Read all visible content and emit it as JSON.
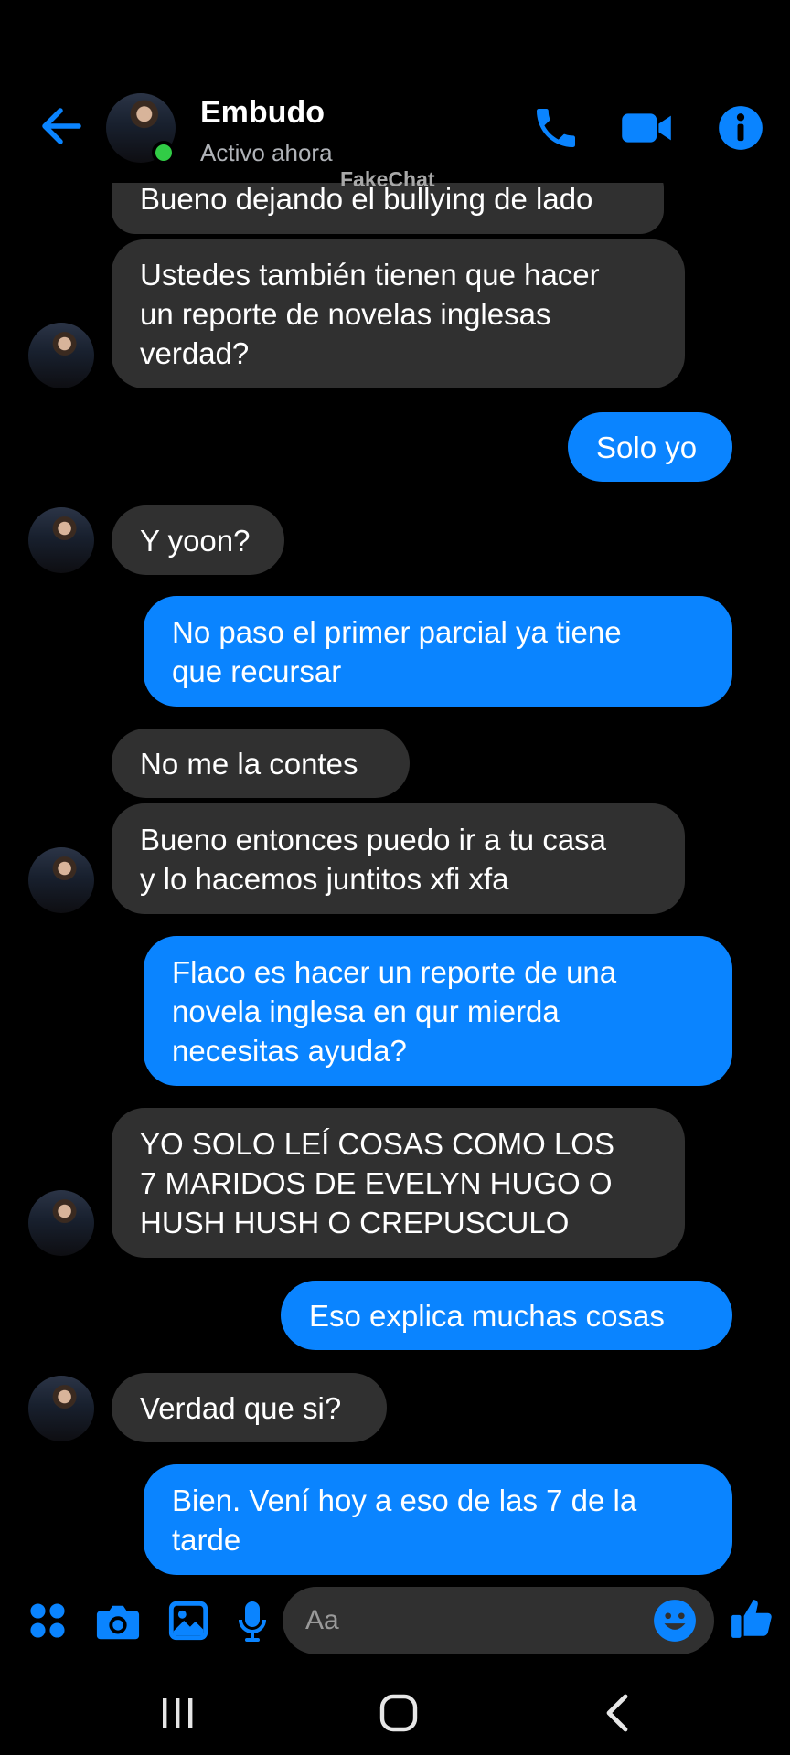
{
  "header": {
    "back_icon": "arrow-left-icon",
    "contact_name": "Embudo",
    "status": "Activo ahora",
    "watermark": "FakeChat",
    "call_icon": "phone-icon",
    "video_icon": "video-camera-icon",
    "info_icon": "info-icon",
    "accent_color": "#0a84ff",
    "online_color": "#31cc46"
  },
  "messages": [
    {
      "from": "contact",
      "text": "Bueno dejando el bullying de lado"
    },
    {
      "from": "contact",
      "text": "Ustedes también tienen que hacer\nun reporte de novelas inglesas\nverdad?"
    },
    {
      "from": "me",
      "text": "Solo yo"
    },
    {
      "from": "contact",
      "text": "Y yoon?"
    },
    {
      "from": "me",
      "text": "No paso el primer parcial ya tiene\nque recursar"
    },
    {
      "from": "contact",
      "text": "No me la contes"
    },
    {
      "from": "contact",
      "text": "Bueno entonces puedo ir a tu casa\ny lo hacemos juntitos xfi xfa"
    },
    {
      "from": "me",
      "text": "Flaco es hacer un reporte de una\nnovela inglesa en qur mierda\nnecesitas ayuda?"
    },
    {
      "from": "contact",
      "text": "YO SOLO LEÍ COSAS COMO LOS\n7 MARIDOS DE EVELYN HUGO O\nHUSH HUSH O CREPUSCULO"
    },
    {
      "from": "me",
      "text": "Eso explica muchas cosas"
    },
    {
      "from": "contact",
      "text": "Verdad que si?"
    },
    {
      "from": "me",
      "text": "Bien. Vení hoy a eso de las 7 de la\ntarde"
    }
  ],
  "composer": {
    "placeholder": "Aa",
    "icons": [
      "apps-grid-icon",
      "camera-icon",
      "gallery-icon",
      "microphone-icon",
      "emoji-icon",
      "thumbs-up-icon"
    ]
  },
  "colors": {
    "incoming_bubble": "#303030",
    "outgoing_bubble": "#0a84ff",
    "background": "#000000"
  },
  "navbar": {
    "icons": [
      "recent-apps-icon",
      "home-icon",
      "back-nav-icon"
    ]
  }
}
